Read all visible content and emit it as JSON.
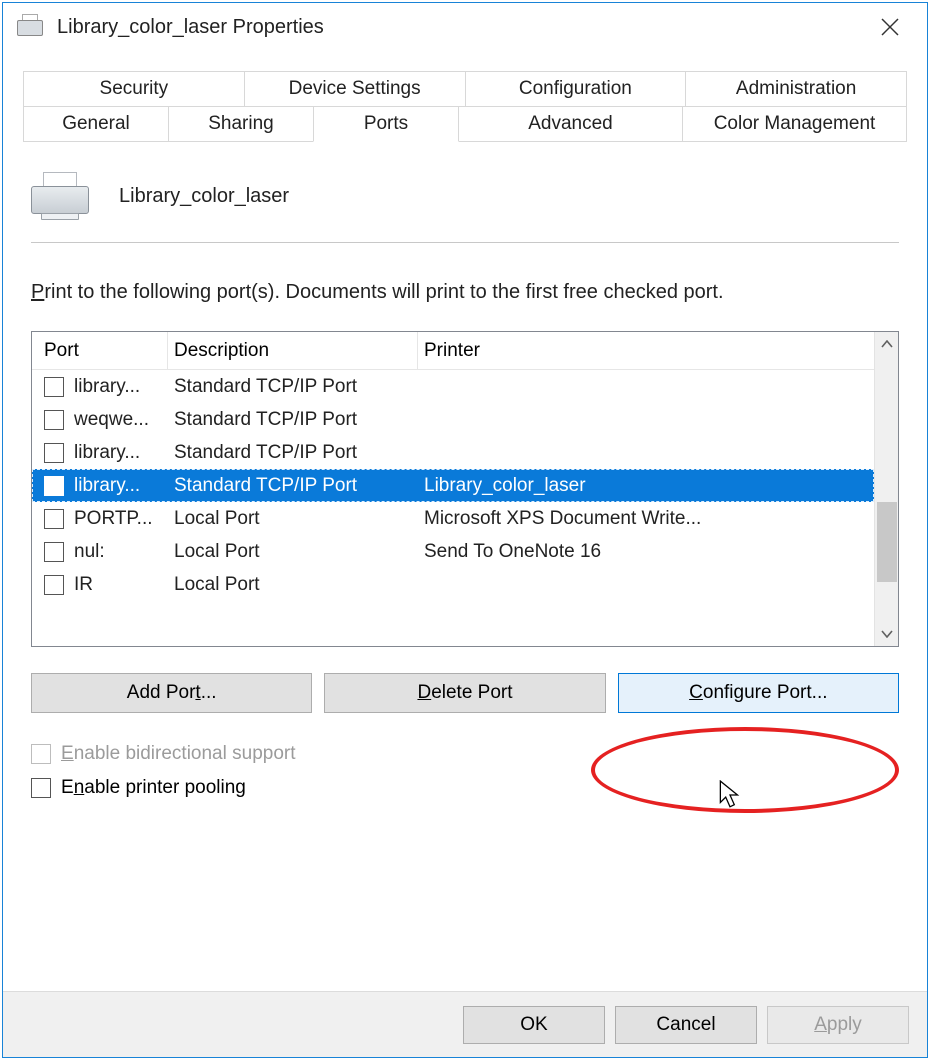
{
  "window": {
    "title": "Library_color_laser Properties"
  },
  "tabs": {
    "row_top": [
      "Security",
      "Device Settings",
      "Configuration",
      "Administration"
    ],
    "row_bottom": [
      "General",
      "Sharing",
      "Ports",
      "Advanced",
      "Color Management"
    ],
    "active": "Ports"
  },
  "printer": {
    "name": "Library_color_laser"
  },
  "instruction": {
    "prefix": "P",
    "rest": "rint to the following port(s). Documents will print to the first free checked port."
  },
  "columns": {
    "port": "Port",
    "description": "Description",
    "printer": "Printer"
  },
  "ports": [
    {
      "checked": false,
      "selected": false,
      "port": "library...",
      "description": "Standard TCP/IP Port",
      "printer": ""
    },
    {
      "checked": false,
      "selected": false,
      "port": "weqwe...",
      "description": "Standard TCP/IP Port",
      "printer": ""
    },
    {
      "checked": false,
      "selected": false,
      "port": "library...",
      "description": "Standard TCP/IP Port",
      "printer": ""
    },
    {
      "checked": true,
      "selected": true,
      "port": "library...",
      "description": "Standard TCP/IP Port",
      "printer": "Library_color_laser"
    },
    {
      "checked": false,
      "selected": false,
      "port": "PORTP...",
      "description": "Local Port",
      "printer": "Microsoft XPS Document Write..."
    },
    {
      "checked": false,
      "selected": false,
      "port": "nul:",
      "description": "Local Port",
      "printer": "Send To OneNote 16"
    },
    {
      "checked": false,
      "selected": false,
      "port": "IR",
      "description": "Local Port",
      "printer": ""
    }
  ],
  "buttons": {
    "add": {
      "u": "t",
      "pre": "Add Por",
      "post": "..."
    },
    "delete": {
      "u": "D",
      "pre": "",
      "post": "elete Port"
    },
    "configure": {
      "u": "C",
      "pre": "",
      "post": "onfigure Port..."
    }
  },
  "checkboxes": {
    "bidi": {
      "u": "E",
      "pre": "",
      "post": "nable bidirectional support",
      "enabled": false
    },
    "pool": {
      "u": "n",
      "pre": "E",
      "post": "able printer pooling",
      "enabled": true
    }
  },
  "bottom": {
    "ok": "OK",
    "cancel": "Cancel",
    "apply_u": "A",
    "apply_post": "pply"
  }
}
